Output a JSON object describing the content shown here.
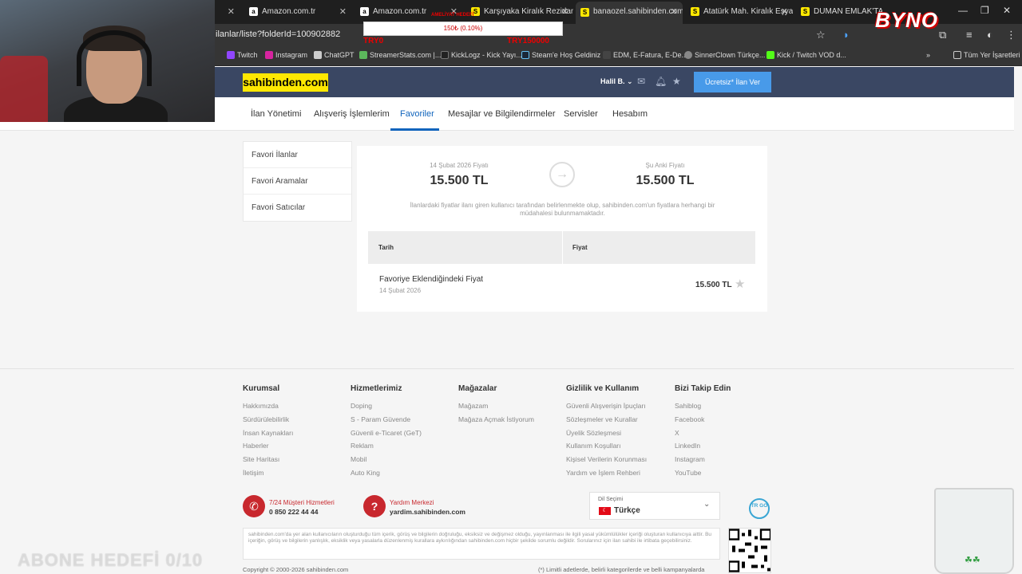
{
  "browser": {
    "tabs": [
      {
        "label": "",
        "favicon": "a"
      },
      {
        "label": "Amazon.com.tr",
        "favicon": "a"
      },
      {
        "label": "Amazon.com.tr",
        "favicon": "a"
      },
      {
        "label": "Karşıyaka Kiralık Rezidans",
        "favicon": "S"
      },
      {
        "label": "banaozel.sahibinden.com",
        "favicon": "S"
      },
      {
        "label": "Atatürk Mah. Kiralık Eşya",
        "favicon": "S"
      },
      {
        "label": "DUMAN EMLAK'TAN EĞ",
        "favicon": "S"
      }
    ],
    "url": "ilanlar/liste?folderId=100902882",
    "bookmarks": [
      "Twitch",
      "Instagram",
      "ChatGPT",
      "StreamerStats.com |...",
      "KickLogz - Kick Yayı...",
      "Steam'e Hoş Geldiniz",
      "EDM, E-Fatura, E-De...",
      "SinnerClown Türkçe...",
      "Kick / Twitch VOD d..."
    ],
    "bookmarks_all": "Tüm Yer İşaretleri"
  },
  "site": {
    "logo": "sahibinden.com",
    "user": "Halil B.",
    "post_button": "Ücretsiz* İlan Ver",
    "nav": [
      "İlan Yönetimi",
      "Alışveriş İşlemlerim",
      "Favoriler",
      "Mesajlar ve Bilgilendirmeler",
      "Servisler",
      "Hesabım"
    ],
    "side_menu": [
      "Favori İlanlar",
      "Favori Aramalar",
      "Favori Satıcılar"
    ]
  },
  "price_card": {
    "old_label": "14 Şubat 2026 Fiyatı",
    "old_value": "15.500 TL",
    "new_label": "Şu Anki Fiyatı",
    "new_value": "15.500 TL",
    "notice": "İlanlardaki fiyatlar ilanı giren kullanıcı tarafından belirlenmekte olup, sahibinden.com'un fiyatlara herhangi bir müdahalesi bulunmamaktadır.",
    "col_date": "Tarih",
    "col_price": "Fiyat",
    "row_title": "Favoriye Eklendiğindeki Fiyat",
    "row_date": "14 Şubat 2026",
    "row_price": "15.500 TL"
  },
  "footer": {
    "columns": [
      {
        "title": "Kurumsal",
        "links": [
          "Hakkımızda",
          "Sürdürülebilirlik",
          "İnsan Kaynakları",
          "Haberler",
          "Site Haritası",
          "İletişim"
        ]
      },
      {
        "title": "Hizmetlerimiz",
        "links": [
          "Doping",
          "S - Param Güvende",
          "Güvenli e-Ticaret (GeT)",
          "Reklam",
          "Mobil",
          "Auto King"
        ]
      },
      {
        "title": "Mağazalar",
        "links": [
          "Mağazam",
          "Mağaza Açmak İstiyorum"
        ]
      },
      {
        "title": "Gizlilik ve Kullanım",
        "links": [
          "Güvenli Alışverişin İpuçları",
          "Sözleşmeler ve Kurallar",
          "Üyelik Sözleşmesi",
          "Kullanım Koşulları",
          "Kişisel Verilerin Korunması",
          "Yardım ve İşlem Rehberi"
        ]
      },
      {
        "title": "Bizi Takip Edin",
        "links": [
          "Sahiblog",
          "Facebook",
          "X",
          "LinkedIn",
          "Instagram",
          "YouTube"
        ]
      }
    ],
    "support_title": "7/24 Müşteri Hizmetleri",
    "support_phone": "0 850 222 44 44",
    "help_title": "Yardım Merkezi",
    "help_url": "yardim.sahibinden.com",
    "lang_label": "Dil Seçimi",
    "lang_value": "Türkçe",
    "trgo": "TR GO",
    "disclaimer": "sahibinden.com'da yer alan kullanıcıların oluşturduğu tüm içerik, görüş ve bilgilerin doğruluğu, eksiksiz ve değişmez olduğu, yayınlanması ile ilgili yasal yükümlülükler içeriği oluşturan kullanıcıya aittir. Bu içeriğin, görüş ve bilgilerin yanlışlık, eksiklik veya yasalarla düzenlenmiş kurallara aykırılığından sahibinden.com hiçbir şekilde sorumlu değildir. Sorularınız için ilan sahibi ile irtibata geçebilirsiniz.",
    "copyright": "Copyright © 2000-2026 sahibinden.com",
    "footnote": "(*) Limitli adetlerde, belirli kategorilerde ve belli kampanyalarda"
  },
  "overlay": {
    "subs_label": "AMELİYAT HEDEFİ",
    "subs_value": "150₺ (0.10%)",
    "tl_left": "TRY0",
    "tl_right": "TRY150000",
    "brand": "BYNO",
    "sub_goal": "ABONE HEDEFİ 0/10"
  }
}
